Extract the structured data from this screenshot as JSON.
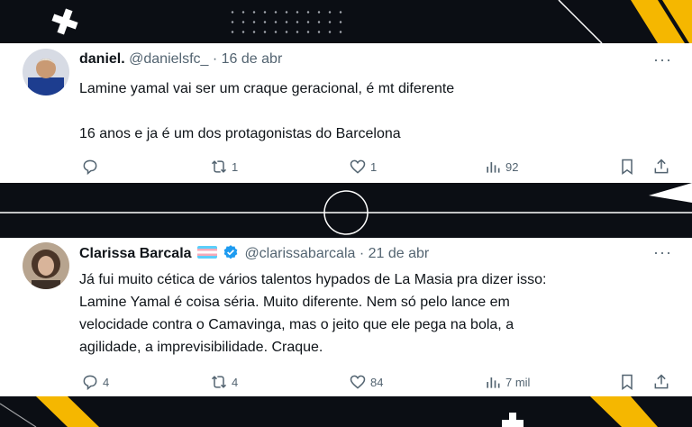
{
  "tweets": [
    {
      "name": "daniel.",
      "handle": "@danielsfc_",
      "separator": " · ",
      "date": "16 de abr",
      "more": "···",
      "line1": "Lamine yamal vai ser um craque geracional, é mt diferente",
      "line2": "16 anos e ja é um dos protagonistas do Barcelona",
      "reply_count": "",
      "retweet_count": "1",
      "like_count": "1",
      "views_count": "92"
    },
    {
      "name": "Clarissa Barcala",
      "handle": "@clarissabarcala",
      "separator": " · ",
      "date": "21 de abr",
      "more": "···",
      "lines": [
        "Já fui muito cética de vários talentos hypados de La Masia pra dizer isso:",
        "Lamine Yamal é coisa séria. Muito diferente. Nem só pelo lance em",
        "velocidade contra o Camavinga, mas o jeito que ele pega na bola, a",
        "agilidade, a imprevisibilidade. Craque."
      ],
      "reply_count": "4",
      "retweet_count": "4",
      "like_count": "84",
      "views_count": "7 mil"
    }
  ],
  "colors": {
    "accent": "#f5b700",
    "verified": "#1d9bf0",
    "text": "#0f1419",
    "muted": "#536471"
  }
}
